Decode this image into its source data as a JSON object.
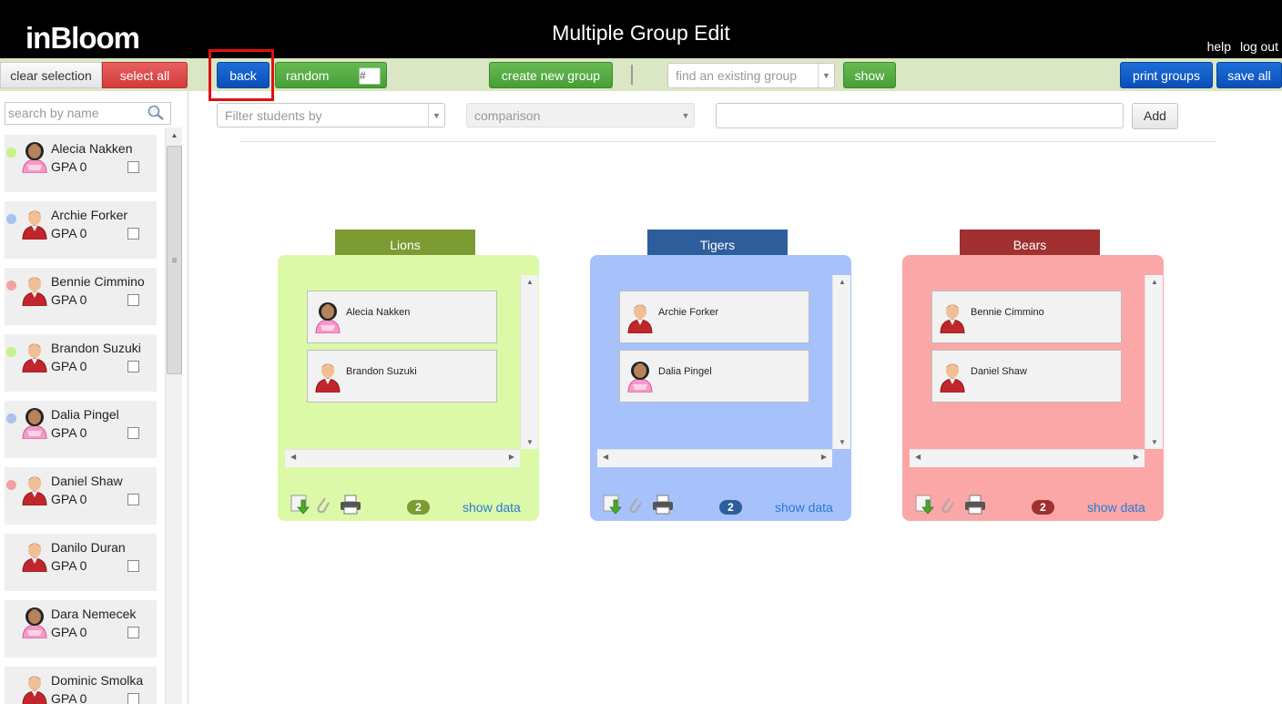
{
  "header": {
    "logo": "inBloom",
    "title": "Multiple Group Edit",
    "help_label": "help",
    "logout_label": "log out"
  },
  "toolbar": {
    "clear_selection": "clear selection",
    "select_all": "select all",
    "back": "back",
    "random": "random",
    "hash": "#",
    "create_new_group": "create new group",
    "find_group_placeholder": "find an existing group",
    "show": "show",
    "print_groups": "print groups",
    "save_all": "save all"
  },
  "filter": {
    "filter_placeholder": "Filter students by",
    "comparison_placeholder": "comparison",
    "value": "",
    "add_label": "Add"
  },
  "sidebar": {
    "search_placeholder": "search by name",
    "students": [
      {
        "name": "Alecia Nakken",
        "gpa": "GPA 0",
        "dot_color": "#c8f08c",
        "avatar": "female"
      },
      {
        "name": "Archie Forker",
        "gpa": "GPA 0",
        "dot_color": "#a8c2f2",
        "avatar": "male"
      },
      {
        "name": "Bennie Cimmino",
        "gpa": "GPA 0",
        "dot_color": "#f2a1a1",
        "avatar": "male"
      },
      {
        "name": "Brandon Suzuki",
        "gpa": "GPA 0",
        "dot_color": "#c8f08c",
        "avatar": "male"
      },
      {
        "name": "Dalia Pingel",
        "gpa": "GPA 0",
        "dot_color": "#a8c2f2",
        "avatar": "female"
      },
      {
        "name": "Daniel Shaw",
        "gpa": "GPA 0",
        "dot_color": "#f2a1a1",
        "avatar": "male"
      },
      {
        "name": "Danilo Duran",
        "gpa": "GPA 0",
        "dot_color": "",
        "avatar": "male"
      },
      {
        "name": "Dara Nemecek",
        "gpa": "GPA 0",
        "dot_color": "",
        "avatar": "female"
      },
      {
        "name": "Dominic Smolka",
        "gpa": "GPA 0",
        "dot_color": "",
        "avatar": "male"
      }
    ]
  },
  "groups": [
    {
      "name": "Lions",
      "tab_color": "#7c9b33",
      "box_color": "#dcf9a8",
      "badge_color": "#7c9b33",
      "count": "2",
      "show_data": "show data",
      "members": [
        {
          "name": "Alecia Nakken",
          "avatar": "female"
        },
        {
          "name": "Brandon Suzuki",
          "avatar": "male"
        }
      ]
    },
    {
      "name": "Tigers",
      "tab_color": "#2e5d9c",
      "box_color": "#a7c2fb",
      "badge_color": "#2e5d9c",
      "count": "2",
      "show_data": "show data",
      "members": [
        {
          "name": "Archie Forker",
          "avatar": "male"
        },
        {
          "name": "Dalia Pingel",
          "avatar": "female"
        }
      ]
    },
    {
      "name": "Bears",
      "tab_color": "#a13030",
      "box_color": "#fca7a7",
      "badge_color": "#a13030",
      "count": "2",
      "show_data": "show data",
      "members": [
        {
          "name": "Bennie Cimmino",
          "avatar": "male"
        },
        {
          "name": "Daniel Shaw",
          "avatar": "male"
        }
      ]
    }
  ]
}
